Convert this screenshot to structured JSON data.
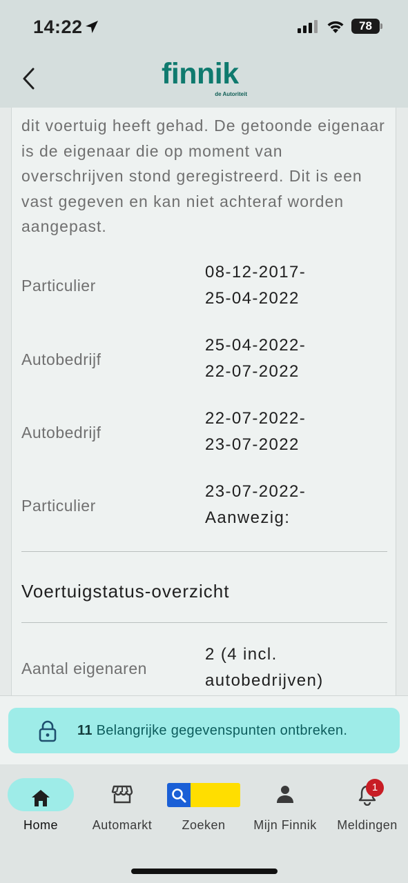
{
  "status_bar": {
    "time": "14:22",
    "battery": "78"
  },
  "header": {
    "logo_text": "finnik",
    "logo_subtext": "de Autoriteit",
    "back_icon": "chevron-left-icon"
  },
  "owner_history": {
    "paragraph": "dit voertuig heeft gehad. De getoonde eigenaar is de eigenaar die op moment van overschrijven stond geregistreerd. Dit is een vast gegeven en kan niet achteraf worden aangepast.",
    "rows": [
      {
        "type": "Particulier",
        "period_line1": "08-12-2017-",
        "period_line2": "25-04-2022"
      },
      {
        "type": "Autobedrijf",
        "period_line1": "25-04-2022-",
        "period_line2": "22-07-2022"
      },
      {
        "type": "Autobedrijf",
        "period_line1": "22-07-2022-",
        "period_line2": "23-07-2022"
      },
      {
        "type": "Particulier",
        "period_line1": "23-07-2022-",
        "period_line2": "Aanwezig:"
      }
    ]
  },
  "status_overview": {
    "title": "Voertuigstatus-overzicht",
    "owners_label": "Aantal eigenaren",
    "owners_value_line1": "2 (4 incl.",
    "owners_value_line2": "autobedrijven)"
  },
  "banner": {
    "count": "11",
    "text": "Belangrijke gegevenspunten ontbreken.",
    "icon": "lock-icon"
  },
  "tabbar": {
    "tabs": [
      {
        "label": "Home",
        "icon": "home-icon",
        "active": true
      },
      {
        "label": "Automarkt",
        "icon": "store-icon",
        "active": false
      },
      {
        "label": "Zoeken",
        "icon": "search-icon",
        "active": false
      },
      {
        "label": "Mijn Finnik",
        "icon": "person-icon",
        "active": false
      },
      {
        "label": "Meldingen",
        "icon": "bell-icon",
        "active": false
      }
    ],
    "notification_count": "1"
  },
  "colors": {
    "brand": "#0f7a6e",
    "accent": "#9eece8",
    "badge": "#c81d25"
  }
}
